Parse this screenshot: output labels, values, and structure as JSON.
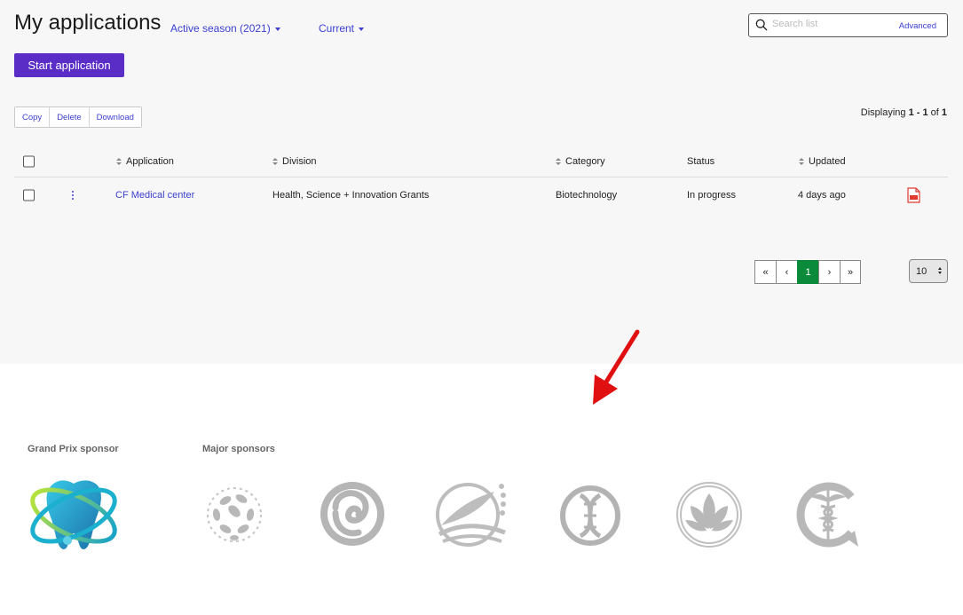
{
  "header": {
    "title": "My applications",
    "season_filter": "Active season (2021)",
    "status_filter": "Current",
    "search_placeholder": "Search list",
    "advanced_label": "Advanced",
    "start_button": "Start application"
  },
  "toolbar": {
    "copy": "Copy",
    "delete": "Delete",
    "download": "Download"
  },
  "pagination_info": {
    "prefix": "Displaying ",
    "range": "1 - 1",
    "of": " of ",
    "total": "1"
  },
  "table": {
    "columns": {
      "application": "Application",
      "division": "Division",
      "category": "Category",
      "status": "Status",
      "updated": "Updated"
    },
    "rows": [
      {
        "application": "CF Medical center",
        "division": "Health, Science + Innovation Grants",
        "category": "Biotechnology",
        "status": "In progress",
        "updated": "4 days ago"
      }
    ]
  },
  "pager": {
    "first": "«",
    "prev": "‹",
    "current": "1",
    "next": "›",
    "last": "»",
    "page_size": "10"
  },
  "sponsors": {
    "grand_prix_label": "Grand Prix sponsor",
    "major_label": "Major sponsors"
  },
  "colors": {
    "primary_button": "#5a2ec6",
    "link": "#3b3fd0",
    "active_page": "#0a8a3a",
    "annotation_arrow": "#e01010"
  }
}
